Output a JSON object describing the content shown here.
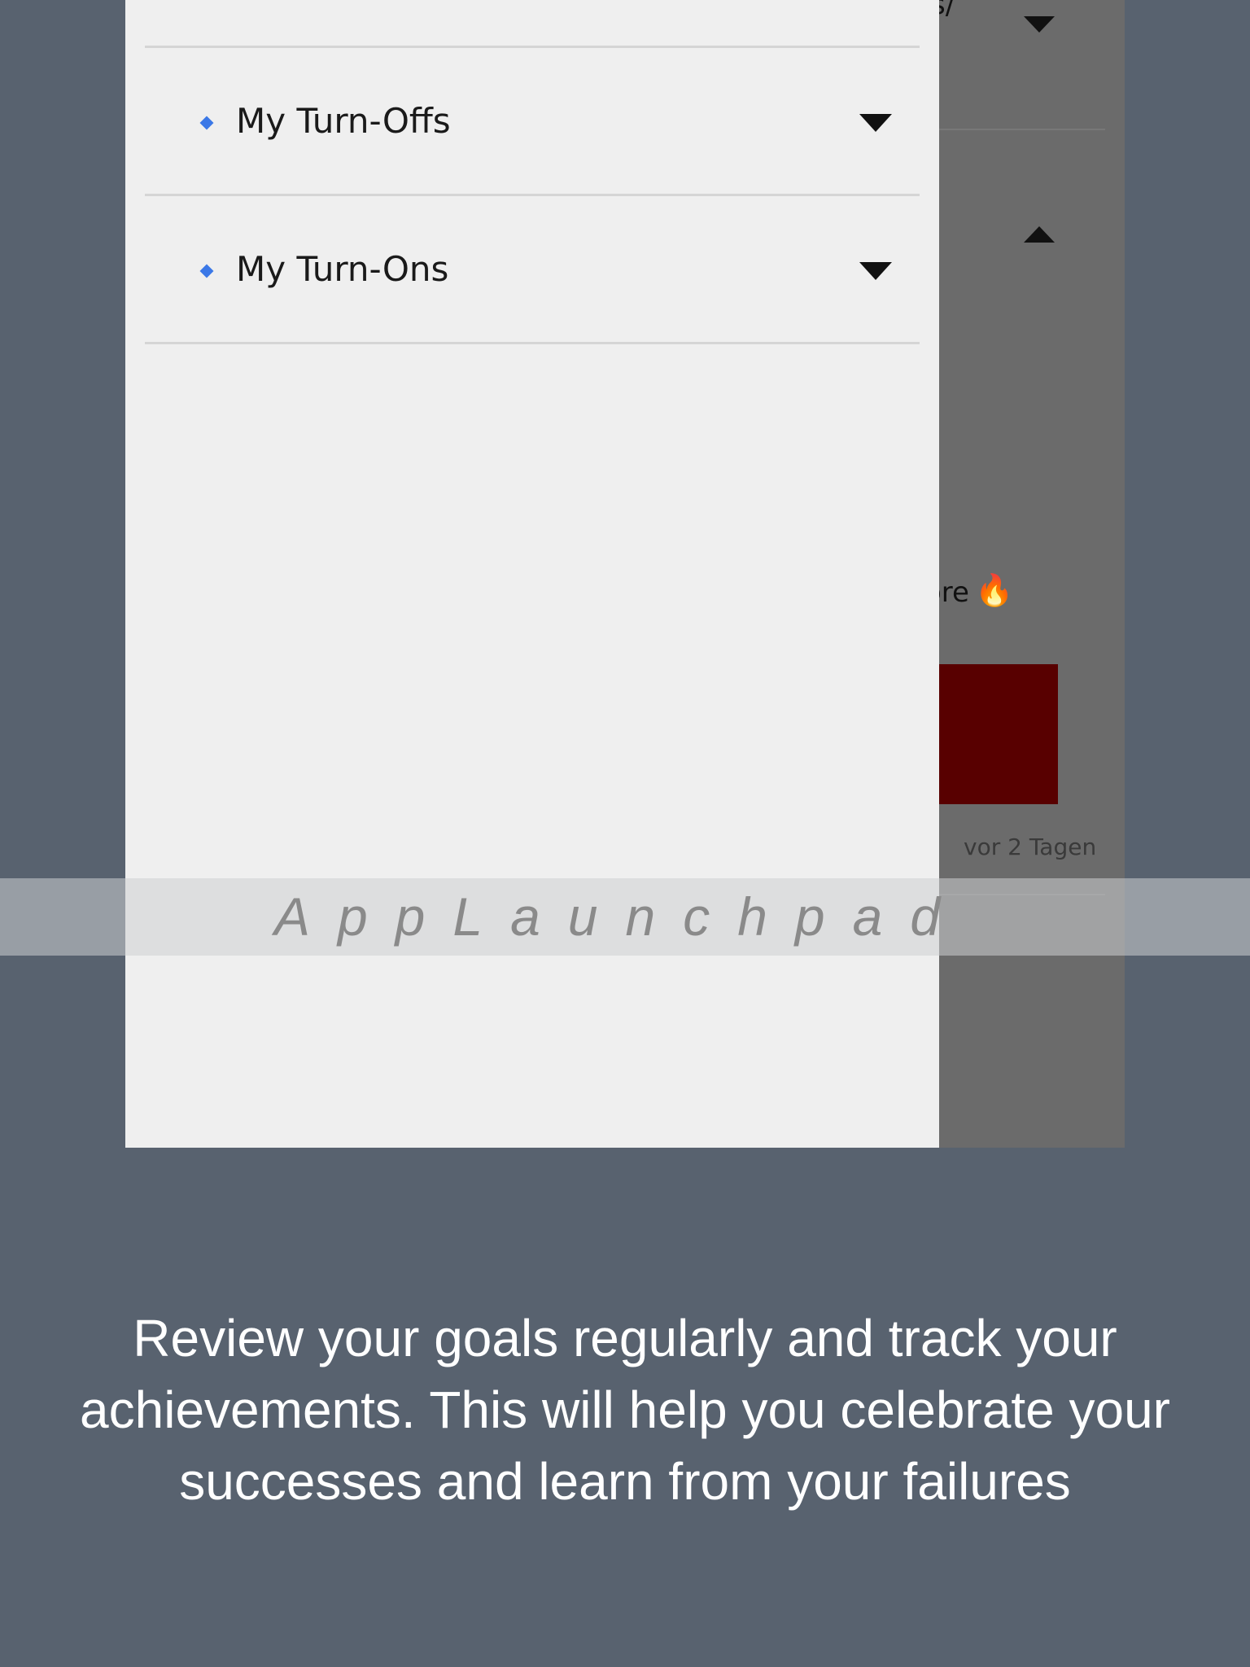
{
  "background_screen": {
    "cut_text_top": "s/",
    "cut_text_mid": "ore",
    "fire_emoji": "🔥",
    "time_ago": "vor 2 Tagen"
  },
  "drawer": {
    "items": [
      {
        "label": "My Turn-Offs",
        "icon": "diamond-bullet-icon",
        "caret": "chevron-down-icon"
      },
      {
        "label": "My Turn-Ons",
        "icon": "diamond-bullet-icon",
        "caret": "chevron-down-icon"
      }
    ]
  },
  "watermark": "AppLaunchpad",
  "caption": "Review your goals regularly and track your achievements. This will help you celebrate your successes and learn from your failures",
  "colors": {
    "page_bg": "#58626f",
    "drawer_bg": "#efefef",
    "bullet": "#3b78e7",
    "thumbnail": "#580000"
  }
}
